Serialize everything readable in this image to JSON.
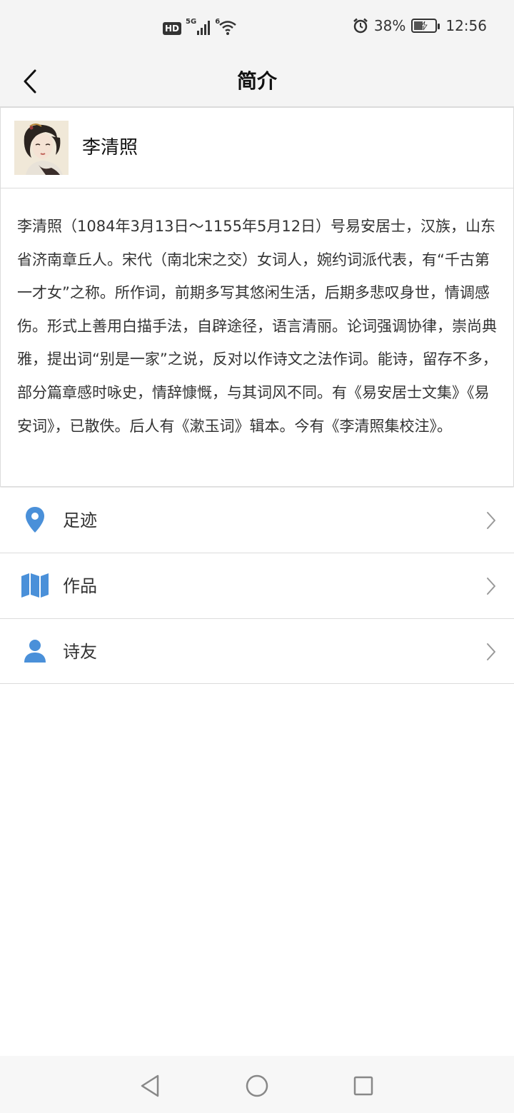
{
  "status_bar": {
    "hd": "HD",
    "network": "5G",
    "wifi_sup": "6",
    "battery": "38%",
    "time": "12:56",
    "icons": [
      "signal-icon",
      "wifi-icon",
      "alarm-icon",
      "battery-icon"
    ]
  },
  "header": {
    "title": "简介",
    "back_icon": "chevron-left-icon"
  },
  "profile": {
    "name": "李清照",
    "bio": "李清照（1084年3月13日～1155年5月12日）号易安居士，汉族，山东省济南章丘人。宋代（南北宋之交）女词人，婉约词派代表，有“千古第一才女”之称。所作词，前期多写其悠闲生活，后期多悲叹身世，情调感伤。形式上善用白描手法，自辟途径，语言清丽。论词强调协律，崇尚典雅，提出词“别是一家”之说，反对以作诗文之法作词。能诗，留存不多，部分篇章感时咏史，情辞慷慨，与其词风不同。有《易安居士文集》《易安词》，已散佚。后人有《漱玉词》辑本。今有《李清照集校注》。"
  },
  "menu": {
    "items": [
      {
        "label": "足迹",
        "icon": "map-pin-icon"
      },
      {
        "label": "作品",
        "icon": "map-icon"
      },
      {
        "label": "诗友",
        "icon": "person-icon"
      }
    ]
  },
  "colors": {
    "accent": "#4a90d9",
    "background": "#ffffff",
    "bar": "#f4f4f4",
    "divider": "#dcdcdc"
  },
  "nav": {
    "icons": [
      "back-triangle-icon",
      "home-circle-icon",
      "recents-square-icon"
    ]
  }
}
